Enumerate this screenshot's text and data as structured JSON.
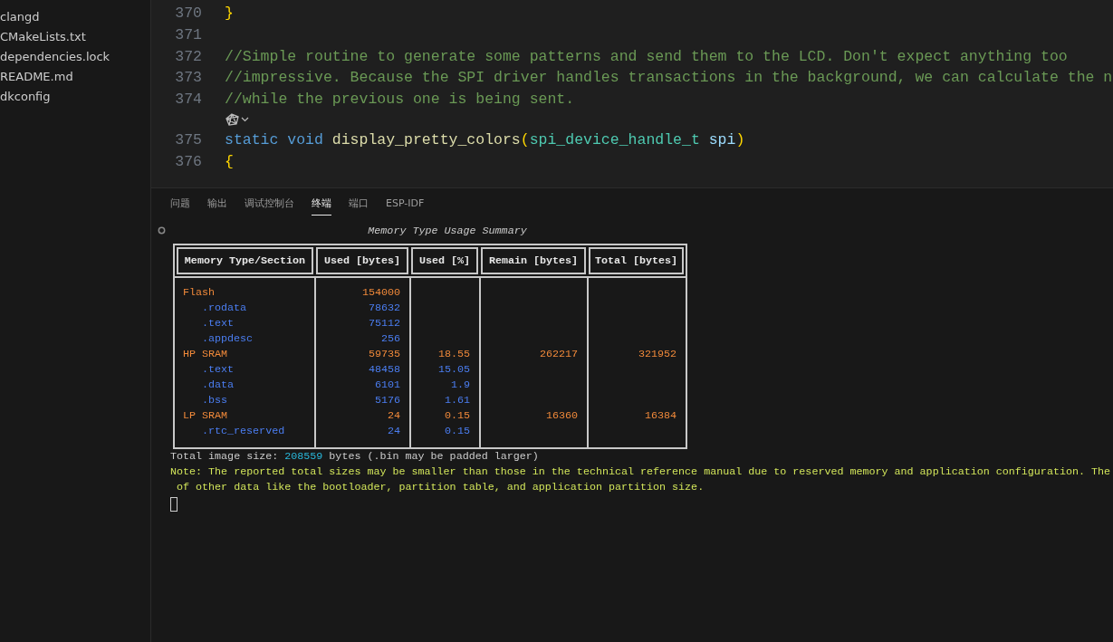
{
  "sidebar": {
    "items": [
      {
        "label": "clangd"
      },
      {
        "label": "CMakeLists.txt"
      },
      {
        "label": "dependencies.lock"
      },
      {
        "label": "README.md"
      },
      {
        "label": "dkconfig"
      }
    ]
  },
  "editor": {
    "lines": [
      {
        "kind": "code",
        "number": "370",
        "tokens": [
          {
            "kind": "bracket",
            "text": "}"
          }
        ]
      },
      {
        "kind": "code",
        "number": "371"
      },
      {
        "kind": "code",
        "number": "372",
        "tokens": [
          {
            "kind": "comment",
            "text": "//Simple routine to generate some patterns and send them to the LCD. Don't expect anything too"
          }
        ]
      },
      {
        "kind": "code",
        "number": "373",
        "tokens": [
          {
            "kind": "comment",
            "text": "//impressive. Because the SPI driver handles transactions in the background, we can calculate the n"
          }
        ]
      },
      {
        "kind": "code",
        "number": "374",
        "tokens": [
          {
            "kind": "comment",
            "text": "//while the previous one is being sent."
          }
        ]
      },
      {
        "kind": "codelens"
      },
      {
        "kind": "code",
        "number": "375",
        "tokens": [
          {
            "kind": "keyword",
            "text": "static void"
          },
          {
            "kind": "function",
            "text": "display_pretty_colors"
          },
          {
            "kind": "bracket",
            "text": "("
          },
          {
            "kind": "type",
            "text": "spi_device_handle_t"
          },
          {
            "kind": "variable",
            "text": "spi"
          },
          {
            "kind": "bracket",
            "text": ")"
          }
        ]
      },
      {
        "kind": "code",
        "number": "376",
        "tokens": [
          {
            "kind": "bracket",
            "text": "{"
          }
        ]
      }
    ]
  },
  "panel": {
    "tabs": [
      {
        "label": "问题",
        "selected": false
      },
      {
        "label": "输出",
        "selected": false
      },
      {
        "label": "调试控制台",
        "selected": false
      },
      {
        "label": "终端",
        "selected": true
      },
      {
        "label": "端口",
        "selected": false
      },
      {
        "label": "ESP-IDF",
        "selected": false
      }
    ],
    "terminal": {
      "table_title": "Memory Type Usage Summary",
      "columns": [
        "Memory Type/Section",
        "Used [bytes]",
        "Used [%]",
        "Remain [bytes]",
        "Total [bytes]"
      ],
      "rows": [
        {
          "kind": "group",
          "name": "Flash",
          "used": "154000"
        },
        {
          "kind": "section",
          "name": ".rodata",
          "used": "78632"
        },
        {
          "kind": "section",
          "name": ".text",
          "used": "75112"
        },
        {
          "kind": "section",
          "name": ".appdesc",
          "used": "256"
        },
        {
          "kind": "group",
          "name": "HP SRAM",
          "used": "59735",
          "used_pct": "18.55",
          "remain": "262217",
          "total": "321952"
        },
        {
          "kind": "section",
          "name": ".text",
          "used": "48458",
          "used_pct": "15.05"
        },
        {
          "kind": "section",
          "name": ".data",
          "used": "6101",
          "used_pct": "1.9"
        },
        {
          "kind": "section",
          "name": ".bss",
          "used": "5176",
          "used_pct": "1.61"
        },
        {
          "kind": "group",
          "name": "LP SRAM",
          "used": "24",
          "used_pct": "0.15",
          "remain": "16360",
          "total": "16384"
        },
        {
          "kind": "section",
          "name": ".rtc_reserved",
          "used": "24",
          "used_pct": "0.15"
        }
      ],
      "total_prefix": "Total image size: ",
      "total_value": "208559",
      "total_suffix": " bytes (.bin may be padded larger)",
      "note_lines": [
        "Note: The reported total sizes may be smaller than those in the technical reference manual due to reserved memory and application configuration. The",
        " of other data like the bootloader, partition table, and application partition size."
      ]
    }
  }
}
